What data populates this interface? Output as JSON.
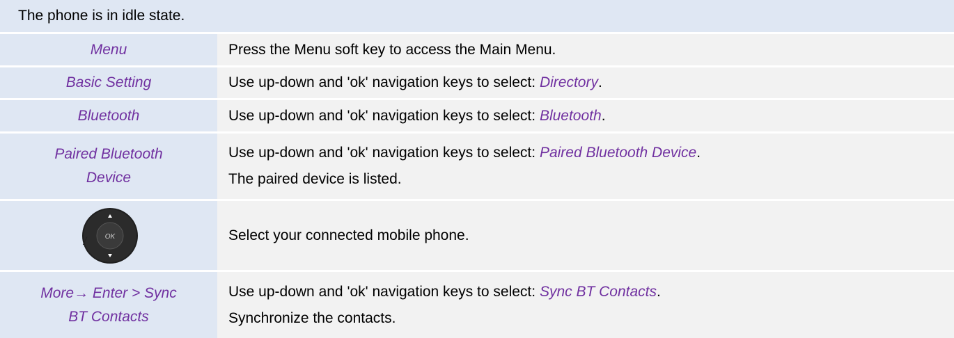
{
  "header": {
    "text": "The phone is in idle state."
  },
  "rows": [
    {
      "left": "Menu",
      "right_text": "Press the Menu soft key to access the Main Menu."
    },
    {
      "left": "Basic Setting",
      "prefix": "Use up-down and 'ok' navigation keys to select: ",
      "keyword": "Directory",
      "suffix": "."
    },
    {
      "left": "Bluetooth",
      "prefix": "Use up-down and 'ok' navigation keys to select: ",
      "keyword": "Bluetooth",
      "suffix": "."
    },
    {
      "left_line1": "Paired Bluetooth",
      "left_line2": "Device",
      "prefix": "Use up-down and 'ok' navigation keys to select: ",
      "keyword": "Paired Bluetooth Device",
      "suffix": ".",
      "line2": "The paired device is listed."
    },
    {
      "icon": "navigation-key-icon",
      "icon_separator": "/",
      "icon_ok": "OK",
      "right_text": "Select your connected mobile phone."
    },
    {
      "left_line1": "More→ Enter > Sync",
      "left_line2": "BT Contacts",
      "prefix": "Use up-down and 'ok' navigation keys to select: ",
      "keyword": "Sync BT Contacts",
      "suffix": ".",
      "line2": "Synchronize the contacts."
    }
  ],
  "colors": {
    "keyword": "#7030a0",
    "header_bg": "#dfe7f3",
    "left_bg": "#dfe7f3",
    "right_bg": "#f2f2f2"
  }
}
